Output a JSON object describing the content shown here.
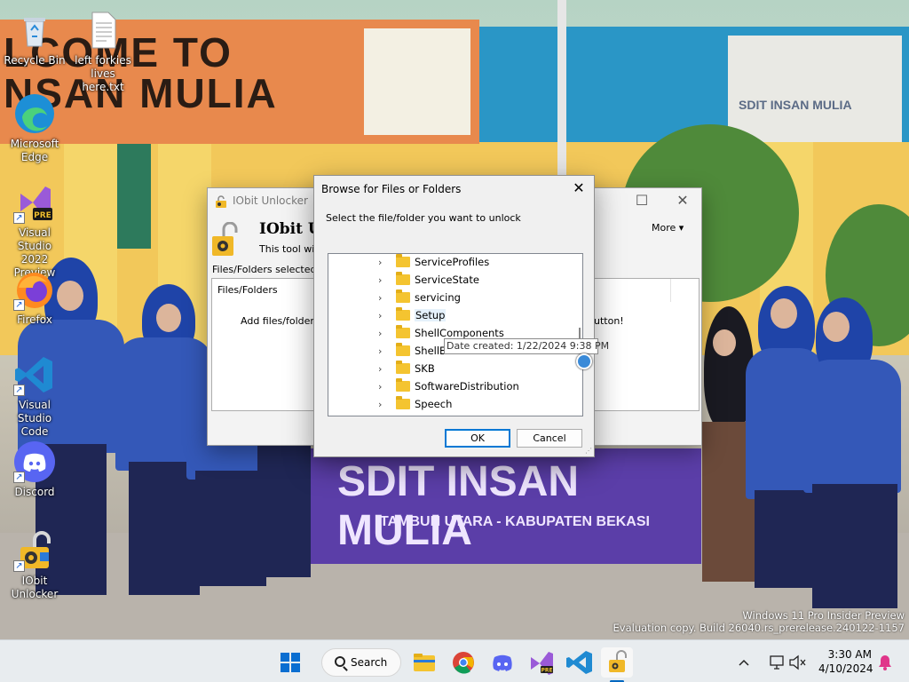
{
  "desktop": {
    "icons": [
      {
        "label": "Recycle Bin"
      },
      {
        "label": "left forkies\nlives here.txt"
      },
      {
        "label": "Microsoft\nEdge"
      },
      {
        "label": "Visual Studio\n2022 Preview"
      },
      {
        "label": "Firefox"
      },
      {
        "label": "Visual Studio\nCode"
      },
      {
        "label": "Discord"
      },
      {
        "label": "IObit\nUnlocker"
      }
    ]
  },
  "wallpaper": {
    "sign_text": "LCOME TO\nNSAN MULIA",
    "board_text": "SDIT INSAN MULIA",
    "banner_line1": "SDIT INSAN MULIA",
    "banner_line2": "TAMBUN UTARA - KABUPATEN BEKASI"
  },
  "iobit": {
    "title": "IObit Unlocker",
    "header_title": "IObit Un",
    "header_sub": "This tool will h",
    "more_label": "More",
    "selected_label": "Files/Folders selected",
    "column_header": "Files/Folders",
    "hint_left": "Add files/folders t",
    "hint_right": "utton!"
  },
  "dialog": {
    "title": "Browse for Files or Folders",
    "prompt": "Select the file/folder you want to unlock",
    "items": [
      {
        "label": "ServiceProfiles"
      },
      {
        "label": "ServiceState"
      },
      {
        "label": "servicing"
      },
      {
        "label": "Setup"
      },
      {
        "label": "ShellComponents"
      },
      {
        "label": "ShellE"
      },
      {
        "label": "SKB"
      },
      {
        "label": "SoftwareDistribution"
      },
      {
        "label": "Speech"
      }
    ],
    "selected_item": "Setup",
    "tooltip": "Date created: 1/22/2024 9:38 PM",
    "ok_label": "OK",
    "cancel_label": "Cancel"
  },
  "watermark": {
    "line1": "Windows 11 Pro Insider Preview",
    "line2": "Evaluation copy. Build 26040.rs_prerelease.240122-1157"
  },
  "taskbar": {
    "search_label": "Search",
    "apps": [
      "start-icon",
      "file-explorer-icon",
      "chrome-icon",
      "discord-icon",
      "visual-studio-icon",
      "vscode-icon",
      "iobit-unlocker-icon"
    ],
    "time": "3:30 AM",
    "date": "4/10/2024"
  },
  "colors": {
    "accent": "#0078d4",
    "folder": "#f4c430",
    "taskbar_bg": "#e8ecef"
  }
}
